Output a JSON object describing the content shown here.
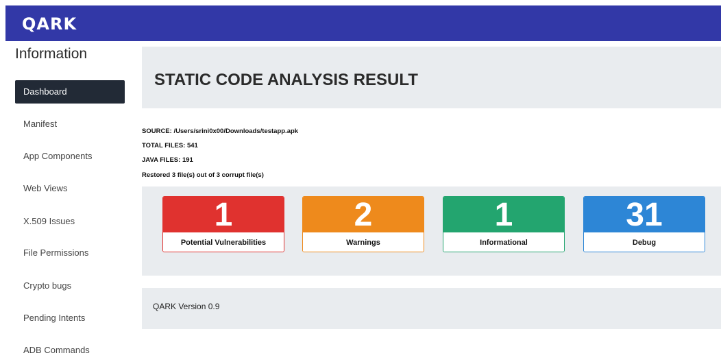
{
  "app": {
    "logo": "QARK"
  },
  "sidebar": {
    "title": "Information",
    "items": [
      {
        "label": "Dashboard",
        "active": true
      },
      {
        "label": "Manifest"
      },
      {
        "label": "App Components"
      },
      {
        "label": "Web Views"
      },
      {
        "label": "X.509 Issues"
      },
      {
        "label": "File Permissions"
      },
      {
        "label": "Crypto bugs"
      },
      {
        "label": "Pending Intents"
      },
      {
        "label": "ADB Commands"
      }
    ]
  },
  "main": {
    "title": "STATIC CODE ANALYSIS RESULT",
    "info": [
      "SOURCE: /Users/srini0x00/Downloads/testapp.apk",
      "TOTAL FILES: 541",
      "JAVA FILES: 191",
      "Restored 3 file(s) out of 3 corrupt file(s)"
    ],
    "cards": [
      {
        "value": "1",
        "label": "Potential Vulnerabilities",
        "color": "#e0322f"
      },
      {
        "value": "2",
        "label": "Warnings",
        "color": "#ee8a1c"
      },
      {
        "value": "1",
        "label": "Informational",
        "color": "#23a56f"
      },
      {
        "value": "31",
        "label": "Debug",
        "color": "#2d86d6"
      }
    ],
    "version": "QARK Version 0.9"
  }
}
